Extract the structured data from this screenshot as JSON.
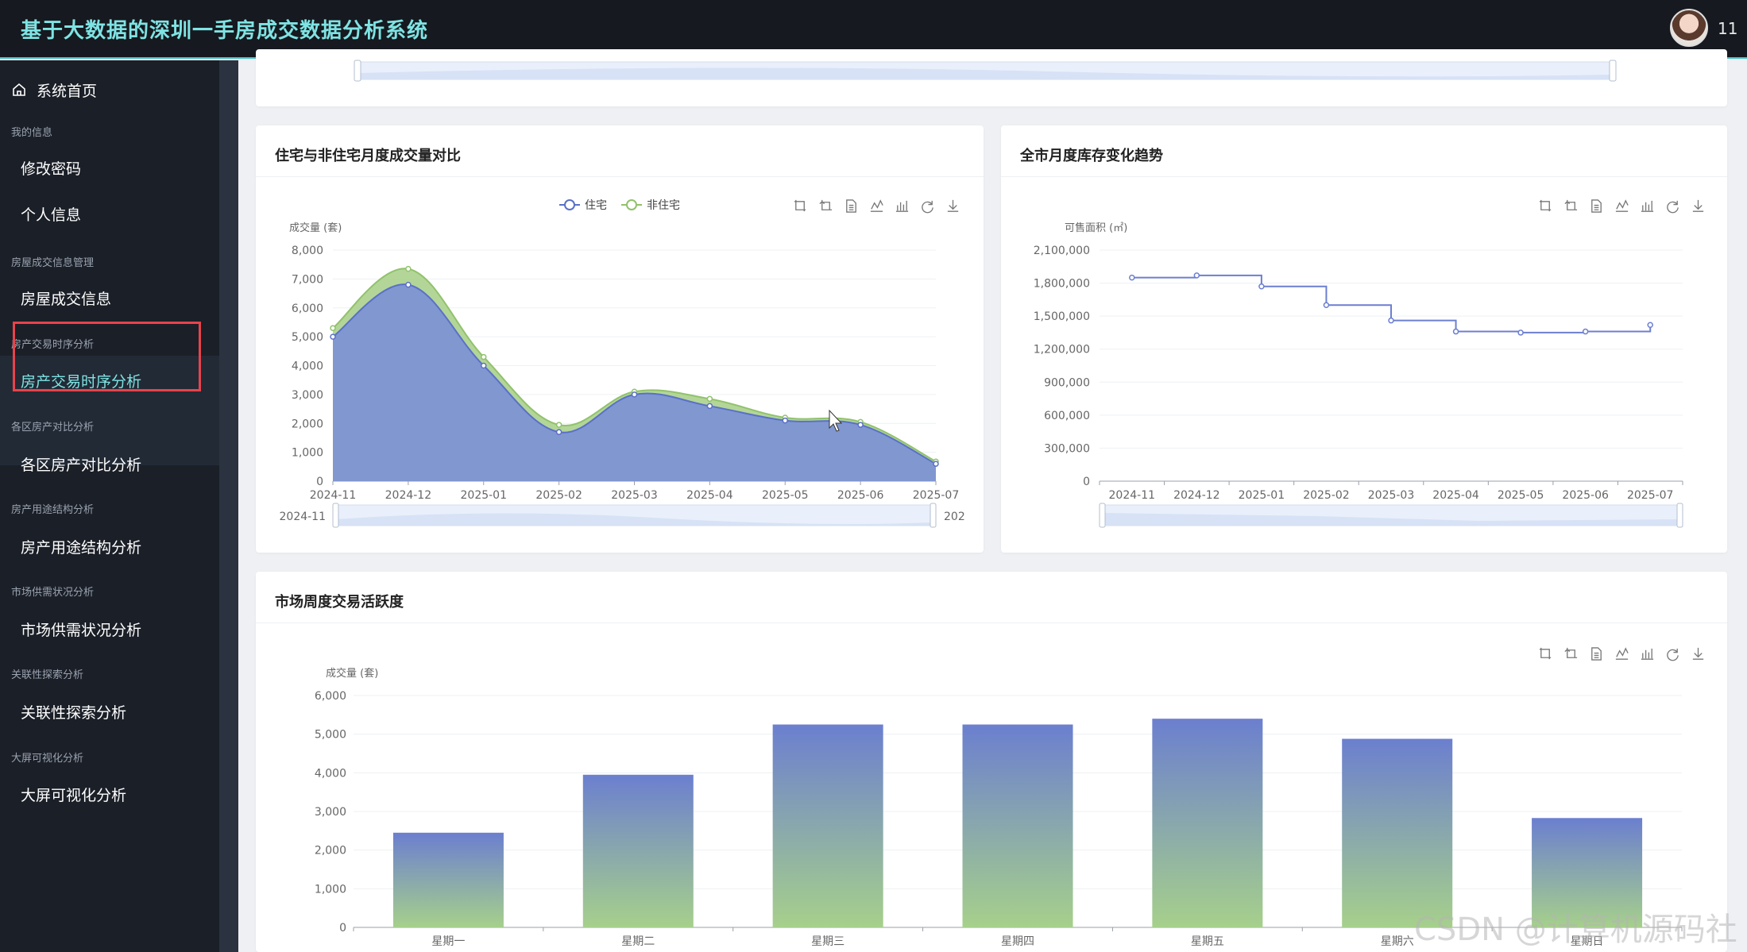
{
  "header": {
    "app_title": "基于大数据的深圳一手房成交数据分析系统",
    "user_name": "11"
  },
  "sidebar": {
    "home_label": "系统首页",
    "groups": [
      {
        "title": "我的信息",
        "items": [
          "修改密码",
          "个人信息"
        ]
      },
      {
        "title": "房屋成交信息管理",
        "items": [
          "房屋成交信息"
        ]
      },
      {
        "title": "房产交易时序分析",
        "items": [
          "房产交易时序分析"
        ]
      },
      {
        "title": "各区房产对比分析",
        "items": [
          "各区房产对比分析"
        ]
      },
      {
        "title": "房产用途结构分析",
        "items": [
          "房产用途结构分析"
        ]
      },
      {
        "title": "市场供需状况分析",
        "items": [
          "市场供需状况分析"
        ]
      },
      {
        "title": "关联性探索分析",
        "items": [
          "关联性探索分析"
        ]
      },
      {
        "title": "大屏可视化分析",
        "items": [
          "大屏可视化分析"
        ]
      }
    ],
    "active_item": "房产交易时序分析"
  },
  "colors": {
    "accent": "#7fe3e3",
    "residential": "#7b90d6",
    "nonresidential": "#a6cf86",
    "line": "#6c7fd1",
    "bar_top": "#6b7fcf",
    "bar_bottom": "#a6d08b",
    "highlight": "#e8434b"
  },
  "toolbox_icons": [
    "zoom-select-icon",
    "zoom-reset-icon",
    "data-view-icon",
    "line-type-icon",
    "bar-type-icon",
    "restore-icon",
    "save-image-icon"
  ],
  "watermark": "CSDN @计算机源码社",
  "chart_data": [
    {
      "title": "住宅与非住宅月度成交量对比",
      "type": "area",
      "stacked": true,
      "smooth": true,
      "ylabel": "成交量 (套)",
      "ylim": [
        0,
        8000
      ],
      "yticks": [
        0,
        1000,
        2000,
        3000,
        4000,
        5000,
        6000,
        7000,
        8000
      ],
      "categories": [
        "2024-11",
        "2024-12",
        "2025-01",
        "2025-02",
        "2025-03",
        "2025-04",
        "2025-05",
        "2025-06",
        "2025-07"
      ],
      "series": [
        {
          "name": "住宅",
          "values": [
            5000,
            6800,
            4000,
            1700,
            3000,
            2600,
            2100,
            1950,
            600
          ]
        },
        {
          "name": "非住宅",
          "values": [
            300,
            550,
            300,
            250,
            100,
            250,
            100,
            100,
            80
          ]
        }
      ],
      "legend_position": "top-center",
      "datazoom_start_label": "2024-11",
      "datazoom_end_label": "202"
    },
    {
      "title": "全市月度库存变化趋势",
      "type": "line",
      "step": true,
      "ylabel": "可售面积 (㎡)",
      "ylim": [
        0,
        2100000
      ],
      "yticks": [
        0,
        300000,
        600000,
        900000,
        1200000,
        1500000,
        1800000,
        2100000
      ],
      "ytick_labels": [
        "0",
        "300,000",
        "600,000",
        "900,000",
        "1,200,000",
        "1,500,000",
        "1,800,000",
        "2,100,000"
      ],
      "categories": [
        "2024-11",
        "2024-12",
        "2025-01",
        "2025-02",
        "2025-03",
        "2025-04",
        "2025-05",
        "2025-06",
        "2025-07"
      ],
      "values": [
        1850000,
        1870000,
        1770000,
        1600000,
        1460000,
        1360000,
        1350000,
        1360000,
        1420000
      ]
    },
    {
      "title": "市场周度交易活跃度",
      "type": "bar",
      "ylabel": "成交量 (套)",
      "ylim": [
        0,
        6000
      ],
      "yticks": [
        0,
        1000,
        2000,
        3000,
        4000,
        5000,
        6000
      ],
      "ytick_labels": [
        "0",
        "1,000",
        "2,000",
        "3,000",
        "4,000",
        "5,000",
        "6,000"
      ],
      "categories": [
        "星期一",
        "星期二",
        "星期三",
        "星期四",
        "星期五",
        "星期六",
        "星期日"
      ],
      "values": [
        2450,
        3950,
        5250,
        5250,
        5400,
        4880,
        2830
      ]
    }
  ]
}
